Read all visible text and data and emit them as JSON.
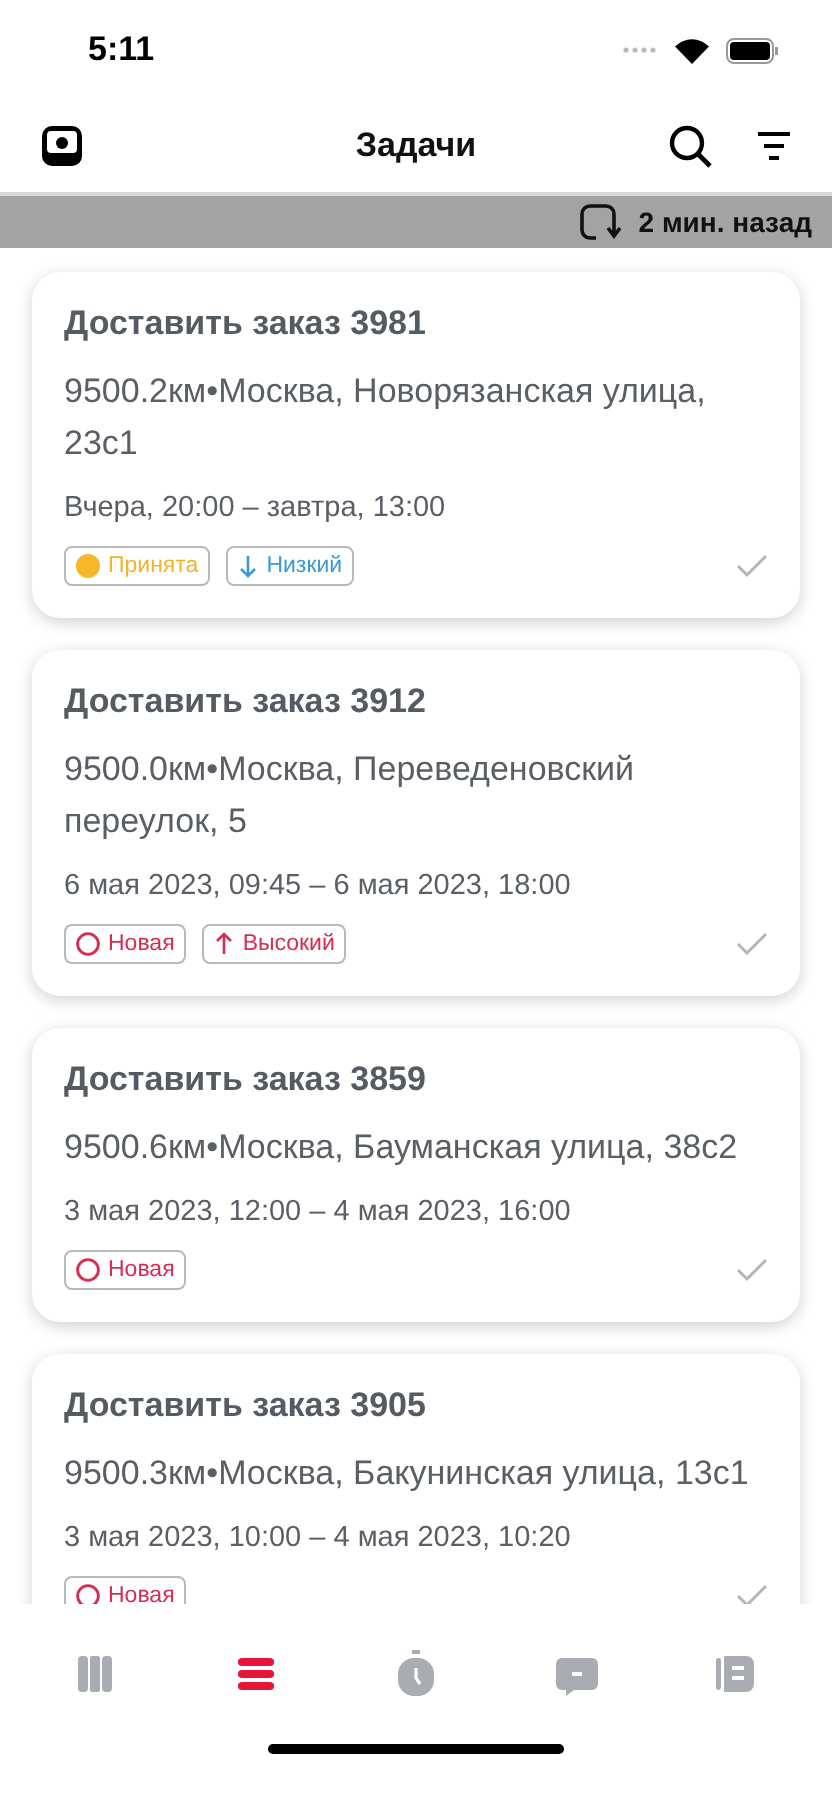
{
  "status_bar": {
    "time": "5:11"
  },
  "header": {
    "title": "Задачи"
  },
  "sync_bar": {
    "text": "2 мин. назад"
  },
  "tasks": [
    {
      "title": "Доставить заказ 3981",
      "address": "9500.2км•Москва, Новорязанская улица, 23с1",
      "time_range": "Вчера, 20:00 – завтра, 13:00",
      "tags": [
        {
          "kind": "accepted",
          "label": "Принята"
        },
        {
          "kind": "low",
          "label": "Низкий"
        }
      ]
    },
    {
      "title": "Доставить заказ 3912",
      "address": "9500.0км•Москва, Переведеновский переулок, 5",
      "time_range": "6 мая 2023, 09:45 – 6 мая 2023, 18:00",
      "tags": [
        {
          "kind": "new",
          "label": "Новая"
        },
        {
          "kind": "high",
          "label": "Высокий"
        }
      ]
    },
    {
      "title": "Доставить заказ 3859",
      "address": "9500.6км•Москва, Бауманская улица, 38с2",
      "time_range": "3 мая 2023, 12:00 – 4 мая 2023, 16:00",
      "tags": [
        {
          "kind": "new",
          "label": "Новая"
        }
      ]
    },
    {
      "title": "Доставить заказ 3905",
      "address": "9500.3км•Москва, Бакунинская улица, 13с1",
      "time_range": "3 мая 2023, 10:00 – 4 мая 2023, 10:20",
      "tags": [
        {
          "kind": "new",
          "label": "Новая"
        }
      ]
    }
  ],
  "tab_bar": {
    "tabs": [
      {
        "kind": "board",
        "selected": false
      },
      {
        "kind": "list",
        "selected": true
      },
      {
        "kind": "timer",
        "selected": false
      },
      {
        "kind": "chat",
        "selected": false
      },
      {
        "kind": "profile",
        "selected": false
      }
    ]
  }
}
